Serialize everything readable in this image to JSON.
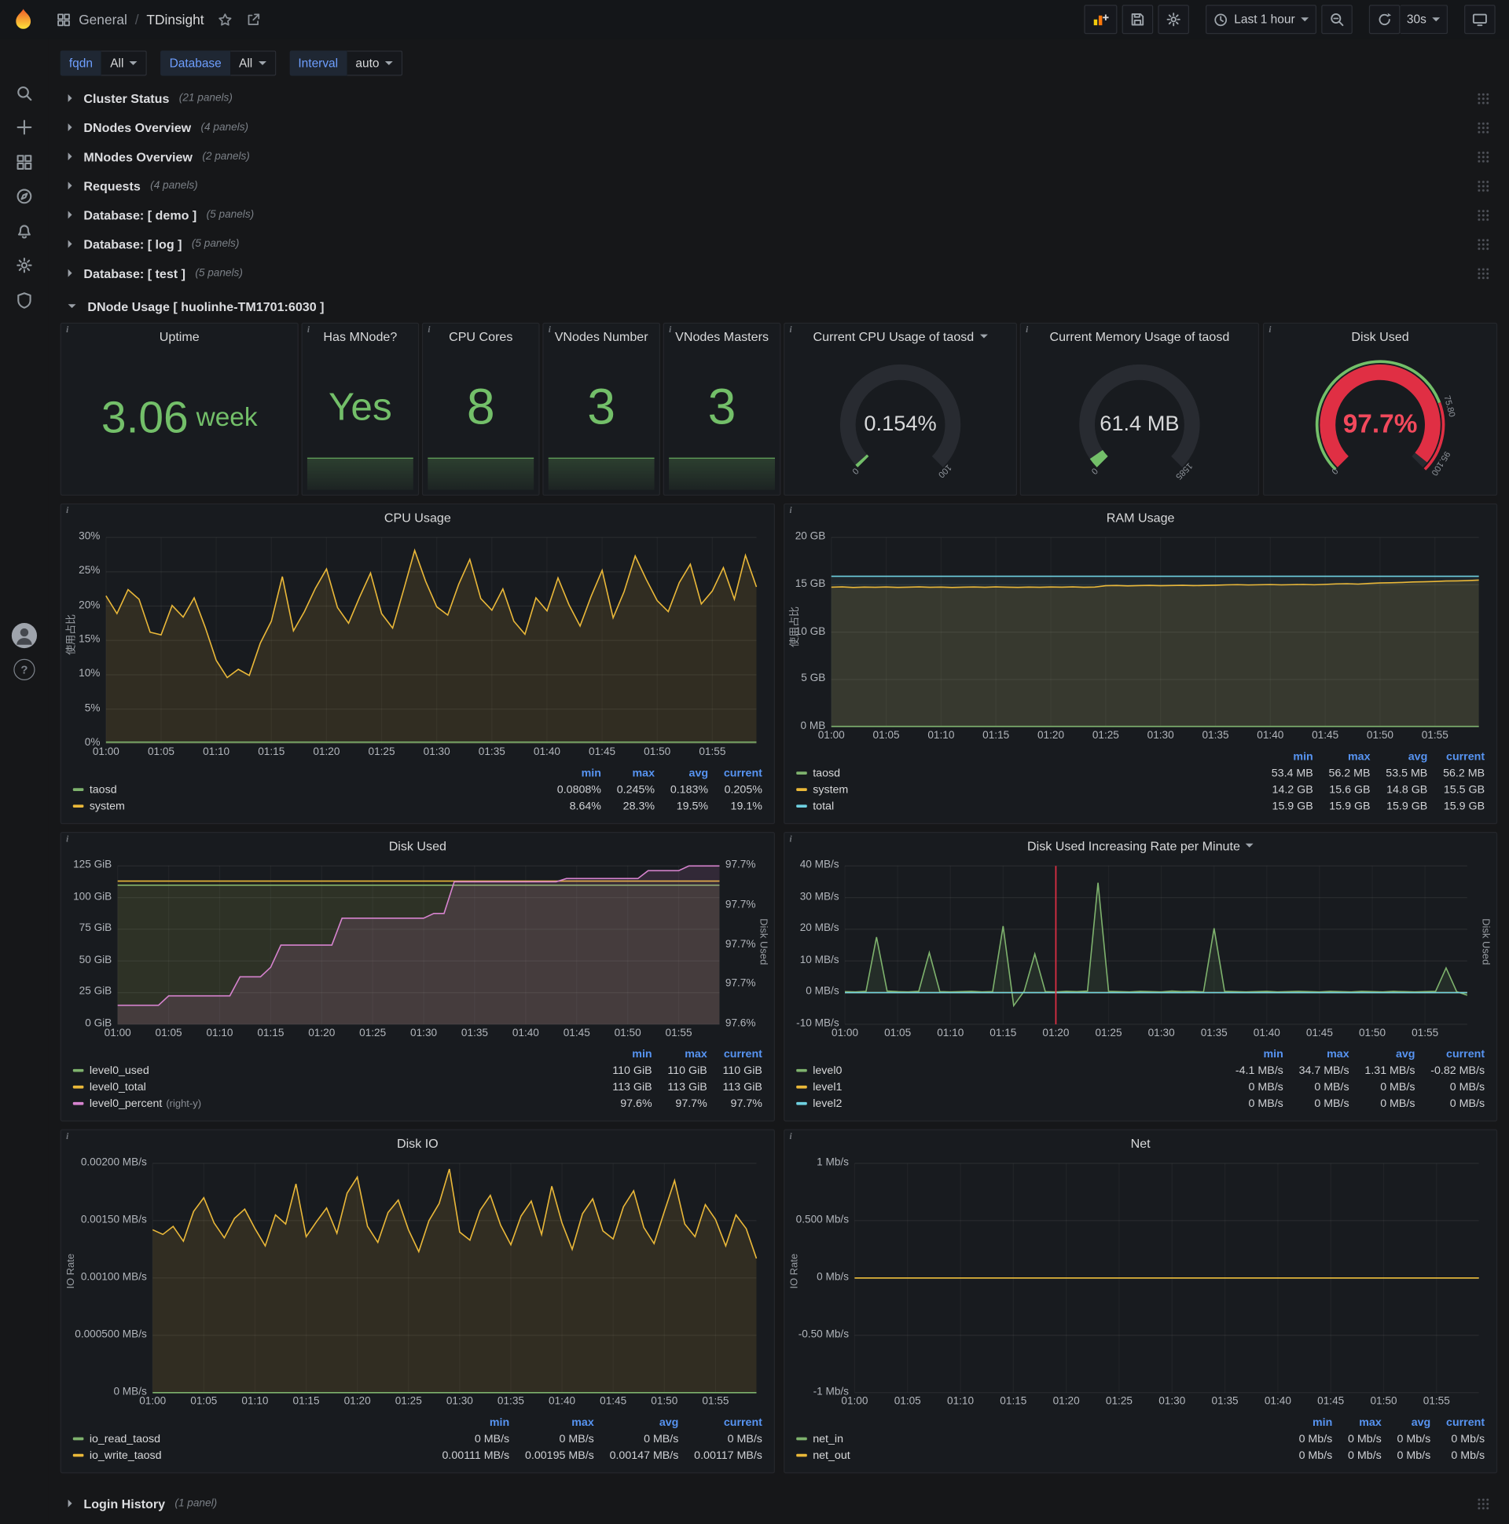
{
  "nav": {
    "section": "General",
    "separator": "/",
    "page": "TDinsight",
    "time_range": "Last 1 hour",
    "refresh": "30s"
  },
  "variables": [
    {
      "label": "fqdn",
      "value": "All"
    },
    {
      "label": "Database",
      "value": "All"
    },
    {
      "label": "Interval",
      "value": "auto"
    }
  ],
  "rows": [
    {
      "title": "Cluster Status",
      "count": "(21 panels)"
    },
    {
      "title": "DNodes Overview",
      "count": "(4 panels)"
    },
    {
      "title": "MNodes Overview",
      "count": "(2 panels)"
    },
    {
      "title": "Requests",
      "count": "(4 panels)"
    },
    {
      "title": "Database: [ demo ]",
      "count": "(5 panels)"
    },
    {
      "title": "Database: [ log ]",
      "count": "(5 panels)"
    },
    {
      "title": "Database: [ test ]",
      "count": "(5 panels)"
    }
  ],
  "expanded_row": {
    "title": "DNode Usage [ huolinhe-TM1701:6030 ]"
  },
  "bottom_row": {
    "title": "Login History",
    "count": "(1 panel)"
  },
  "stats": {
    "uptime": {
      "title": "Uptime",
      "value": "3.06",
      "unit": "week"
    },
    "has_mnode": {
      "title": "Has MNode?",
      "value": "Yes"
    },
    "cpu_cores": {
      "title": "CPU Cores",
      "value": "8"
    },
    "vnodes_number": {
      "title": "VNodes Number",
      "value": "3"
    },
    "vnodes_masters": {
      "title": "VNodes Masters",
      "value": "3"
    }
  },
  "gauges": {
    "cpu": {
      "title": "Current CPU Usage of taosd",
      "value": "0.154%",
      "min": "0",
      "max": "100",
      "fraction": 0.0015,
      "color": "#73bf69"
    },
    "memory": {
      "title": "Current Memory Usage of taosd",
      "value": "61.4 MB",
      "min": "0",
      "max": "1585",
      "fraction": 0.0387,
      "color": "#73bf69"
    },
    "disk": {
      "title": "Disk Used",
      "value": "97.7%",
      "min": "0",
      "fraction": 0.977,
      "color": "#e02f44",
      "labels": [
        {
          "text": "75.80",
          "frac": 0.778
        },
        {
          "text": "95.100",
          "frac": 0.955
        }
      ],
      "thresholds": [
        {
          "to": 0.758,
          "color": "#73bf69"
        },
        {
          "to": 1,
          "color": "#e02f44"
        }
      ]
    }
  },
  "chart_data": [
    {
      "type": "line",
      "title": "CPU Usage",
      "ylabel": "使用占比",
      "ylim": [
        0,
        30
      ],
      "yticks": [
        "30%",
        "25%",
        "20%",
        "15%",
        "10%",
        "5%",
        "0%"
      ],
      "xticks": [
        "01:00",
        "01:05",
        "01:10",
        "01:15",
        "01:20",
        "01:25",
        "01:30",
        "01:35",
        "01:40",
        "01:45",
        "01:50",
        "01:55"
      ],
      "x_minutes": 60,
      "ml": 46,
      "mr": 18,
      "legend_cols": [
        "min",
        "max",
        "avg",
        "current"
      ],
      "series": [
        {
          "name": "system",
          "color": "#eab839",
          "fill": 0.12,
          "values": [
            21.5,
            18.9,
            22.4,
            21.0,
            16.2,
            15.8,
            20.1,
            18.4,
            21.2,
            16.9,
            12.1,
            9.6,
            10.8,
            9.9,
            14.6,
            17.8,
            24.3,
            16.4,
            19.2,
            22.6,
            25.4,
            19.8,
            17.5,
            21.3,
            24.8,
            18.9,
            16.8,
            22.4,
            28.1,
            23.6,
            19.9,
            18.7,
            23.2,
            26.8,
            21.1,
            19.4,
            22.5,
            17.8,
            15.9,
            21.2,
            19.3,
            24.1,
            20.2,
            17.1,
            21.4,
            25.2,
            18.3,
            22.1,
            27.3,
            23.9,
            20.8,
            19.2,
            23.4,
            26.1,
            20.3,
            22.2,
            25.6,
            21.0,
            27.4,
            22.8
          ]
        },
        {
          "name": "taosd",
          "color": "#7eb26d",
          "fill": 0.1,
          "values": {
            "n": 60,
            "const": 0.2
          }
        }
      ],
      "legend": [
        {
          "name": "taosd",
          "color": "#7eb26d",
          "values": [
            "0.0808%",
            "0.245%",
            "0.183%",
            "0.205%"
          ]
        },
        {
          "name": "system",
          "color": "#eab839",
          "values": [
            "8.64%",
            "28.3%",
            "19.5%",
            "19.1%"
          ]
        }
      ]
    },
    {
      "type": "line",
      "title": "RAM Usage",
      "ylabel": "使用占比",
      "ylim": [
        0,
        20
      ],
      "yticks": [
        "20 GB",
        "15 GB",
        "10 GB",
        "5 GB",
        "0 MB"
      ],
      "xticks": [
        "01:00",
        "01:05",
        "01:10",
        "01:15",
        "01:20",
        "01:25",
        "01:30",
        "01:35",
        "01:40",
        "01:45",
        "01:50",
        "01:55"
      ],
      "x_minutes": 60,
      "ml": 48,
      "mr": 18,
      "legend_cols": [
        "min",
        "max",
        "avg",
        "current"
      ],
      "series": [
        {
          "name": "total",
          "color": "#6ed0e0",
          "fill": 0.08,
          "values": {
            "n": 60,
            "const": 15.9
          }
        },
        {
          "name": "system",
          "color": "#eab839",
          "fill": 0.12,
          "values": [
            14.75,
            14.78,
            14.72,
            14.76,
            14.74,
            14.77,
            14.73,
            14.75,
            14.78,
            14.74,
            14.76,
            14.72,
            14.75,
            14.77,
            14.74,
            14.78,
            14.75,
            14.73,
            14.76,
            14.74,
            14.77,
            14.75,
            14.78,
            14.74,
            14.76,
            14.9,
            14.92,
            14.88,
            14.91,
            14.93,
            14.9,
            14.92,
            14.94,
            14.91,
            14.93,
            14.95,
            15.0,
            15.02,
            14.98,
            15.01,
            15.03,
            15.0,
            15.02,
            15.04,
            15.01,
            15.05,
            15.1,
            15.12,
            15.08,
            15.15,
            15.2,
            15.22,
            15.25,
            15.3,
            15.32,
            15.35,
            15.4,
            15.42,
            15.45,
            15.5
          ]
        },
        {
          "name": "taosd",
          "color": "#7eb26d",
          "fill": 0.1,
          "values": {
            "n": 60,
            "const": 0.055
          }
        }
      ],
      "legend": [
        {
          "name": "taosd",
          "color": "#7eb26d",
          "values": [
            "53.4 MB",
            "56.2 MB",
            "53.5 MB",
            "56.2 MB"
          ]
        },
        {
          "name": "system",
          "color": "#eab839",
          "values": [
            "14.2 GB",
            "15.6 GB",
            "14.8 GB",
            "15.5 GB"
          ]
        },
        {
          "name": "total",
          "color": "#6ed0e0",
          "values": [
            "15.9 GB",
            "15.9 GB",
            "15.9 GB",
            "15.9 GB"
          ]
        }
      ]
    },
    {
      "type": "line",
      "title": "Disk Used",
      "ylim": [
        0,
        125
      ],
      "yticks": [
        "125 GiB",
        "100 GiB",
        "75 GiB",
        "50 GiB",
        "25 GiB",
        "0 GiB"
      ],
      "y2lim": [
        97.6,
        97.7
      ],
      "y2ticks": [
        "97.7%",
        "97.7%",
        "97.7%",
        "97.7%",
        "97.6%"
      ],
      "y2label": "Disk Used",
      "xticks": [
        "01:00",
        "01:05",
        "01:10",
        "01:15",
        "01:20",
        "01:25",
        "01:30",
        "01:35",
        "01:40",
        "01:45",
        "01:50",
        "01:55"
      ],
      "x_minutes": 60,
      "ml": 58,
      "mr": 56,
      "legend_cols": [
        "min",
        "max",
        "current"
      ],
      "series": [
        {
          "name": "level0_used",
          "color": "#7eb26d",
          "fill": 0.1,
          "values": {
            "n": 60,
            "const": 109.8
          }
        },
        {
          "name": "level0_total",
          "color": "#eab839",
          "fill": 0.06,
          "values": {
            "n": 60,
            "const": 113
          }
        },
        {
          "name": "level0_percent",
          "color": "#d683ce",
          "fill": 0.14,
          "axis": "right",
          "values": [
            97.612,
            97.612,
            97.612,
            97.612,
            97.612,
            97.618,
            97.618,
            97.618,
            97.618,
            97.618,
            97.618,
            97.618,
            97.63,
            97.63,
            97.63,
            97.636,
            97.65,
            97.65,
            97.65,
            97.65,
            97.65,
            97.65,
            97.667,
            97.667,
            97.667,
            97.667,
            97.667,
            97.667,
            97.667,
            97.667,
            97.667,
            97.67,
            97.67,
            97.69,
            97.69,
            97.69,
            97.69,
            97.69,
            97.69,
            97.69,
            97.69,
            97.69,
            97.69,
            97.69,
            97.692,
            97.692,
            97.692,
            97.692,
            97.692,
            97.692,
            97.692,
            97.692,
            97.697,
            97.697,
            97.697,
            97.697,
            97.7,
            97.7,
            97.7,
            97.7
          ]
        }
      ],
      "legend": [
        {
          "name": "level0_used",
          "color": "#7eb26d",
          "values": [
            "110 GiB",
            "110 GiB",
            "110 GiB"
          ]
        },
        {
          "name": "level0_total",
          "color": "#eab839",
          "values": [
            "113 GiB",
            "113 GiB",
            "113 GiB"
          ]
        },
        {
          "name": "level0_percent",
          "color": "#d683ce",
          "suffix": "(right-y)",
          "values": [
            "97.6%",
            "97.7%",
            "97.7%"
          ]
        }
      ]
    },
    {
      "type": "line",
      "title": "Disk Used Increasing Rate per Minute",
      "ylim": [
        -10,
        40
      ],
      "yticks": [
        "40 MB/s",
        "30 MB/s",
        "20 MB/s",
        "10 MB/s",
        "0 MB/s",
        "-10 MB/s"
      ],
      "y2label": "Disk Used",
      "xticks": [
        "01:00",
        "01:05",
        "01:10",
        "01:15",
        "01:20",
        "01:25",
        "01:30",
        "01:35",
        "01:40",
        "01:45",
        "01:50",
        "01:55"
      ],
      "x_minutes": 60,
      "ml": 62,
      "mr": 30,
      "annotation_min": 20,
      "legend_cols": [
        "min",
        "max",
        "avg",
        "current"
      ],
      "series": [
        {
          "name": "level0",
          "color": "#7eb26d",
          "fill": 0.12,
          "values": [
            0.3,
            0.2,
            0.4,
            17.5,
            0.5,
            0.3,
            0.2,
            0.4,
            12.6,
            0.3,
            0.2,
            0.3,
            0.4,
            0.2,
            0.3,
            21.0,
            -4.1,
            0.5,
            12.2,
            0.3,
            0.2,
            0.4,
            0.3,
            0.5,
            34.7,
            0.4,
            0.3,
            0.2,
            0.4,
            0.3,
            0.2,
            0.5,
            0.3,
            0.4,
            0.2,
            20.3,
            0.4,
            0.3,
            0.2,
            0.3,
            0.4,
            0.2,
            0.3,
            0.4,
            0.3,
            0.2,
            0.4,
            0.3,
            0.2,
            0.4,
            0.3,
            0.2,
            0.4,
            0.3,
            0.2,
            0.3,
            0.4,
            7.8,
            0.3,
            -0.8
          ]
        },
        {
          "name": "level1",
          "color": "#eab839",
          "fill": 0,
          "values": {
            "n": 60,
            "const": 0
          }
        },
        {
          "name": "level2",
          "color": "#6ed0e0",
          "fill": 0,
          "values": {
            "n": 60,
            "const": 0
          }
        }
      ],
      "legend": [
        {
          "name": "level0",
          "color": "#7eb26d",
          "values": [
            "-4.1 MB/s",
            "34.7 MB/s",
            "1.31 MB/s",
            "-0.82 MB/s"
          ]
        },
        {
          "name": "level1",
          "color": "#eab839",
          "values": [
            "0 MB/s",
            "0 MB/s",
            "0 MB/s",
            "0 MB/s"
          ]
        },
        {
          "name": "level2",
          "color": "#6ed0e0",
          "values": [
            "0 MB/s",
            "0 MB/s",
            "0 MB/s",
            "0 MB/s"
          ]
        }
      ]
    },
    {
      "type": "line",
      "title": "Disk IO",
      "ylabel": "IO Rate",
      "ylim": [
        0,
        0.002
      ],
      "yticks": [
        "0.00200 MB/s",
        "0.00150 MB/s",
        "0.00100 MB/s",
        "0.000500 MB/s",
        "0 MB/s"
      ],
      "xticks": [
        "01:00",
        "01:05",
        "01:10",
        "01:15",
        "01:20",
        "01:25",
        "01:30",
        "01:35",
        "01:40",
        "01:45",
        "01:50",
        "01:55"
      ],
      "x_minutes": 60,
      "ml": 94,
      "mr": 18,
      "legend_cols": [
        "min",
        "max",
        "avg",
        "current"
      ],
      "series": [
        {
          "name": "io_write_taosd",
          "color": "#eab839",
          "fill": 0.12,
          "values": [
            0.00142,
            0.00138,
            0.00145,
            0.00132,
            0.00158,
            0.0017,
            0.00148,
            0.00135,
            0.00152,
            0.0016,
            0.00143,
            0.00128,
            0.00155,
            0.00147,
            0.00182,
            0.00136,
            0.00149,
            0.00161,
            0.00139,
            0.00174,
            0.00188,
            0.00145,
            0.00131,
            0.00157,
            0.00168,
            0.00142,
            0.00123,
            0.0015,
            0.00165,
            0.00195,
            0.0014,
            0.00133,
            0.00159,
            0.00172,
            0.00146,
            0.00129,
            0.00154,
            0.00167,
            0.00138,
            0.0018,
            0.00148,
            0.00125,
            0.00156,
            0.00169,
            0.00141,
            0.00134,
            0.00162,
            0.00176,
            0.00144,
            0.0013,
            0.00158,
            0.00185,
            0.00147,
            0.00136,
            0.00164,
            0.00151,
            0.00128,
            0.00155,
            0.00143,
            0.00117
          ]
        },
        {
          "name": "io_read_taosd",
          "color": "#7eb26d",
          "fill": 0.1,
          "values": {
            "n": 60,
            "const": 0
          }
        }
      ],
      "legend": [
        {
          "name": "io_read_taosd",
          "color": "#7eb26d",
          "values": [
            "0 MB/s",
            "0 MB/s",
            "0 MB/s",
            "0 MB/s"
          ]
        },
        {
          "name": "io_write_taosd",
          "color": "#eab839",
          "values": [
            "0.00111 MB/s",
            "0.00195 MB/s",
            "0.00147 MB/s",
            "0.00117 MB/s"
          ]
        }
      ]
    },
    {
      "type": "line",
      "title": "Net",
      "ylabel": "IO Rate",
      "ylim": [
        -1,
        1
      ],
      "yticks": [
        "1 Mb/s",
        "0.500 Mb/s",
        "0 Mb/s",
        "-0.50 Mb/s",
        "-1 Mb/s"
      ],
      "xticks": [
        "01:00",
        "01:05",
        "01:10",
        "01:15",
        "01:20",
        "01:25",
        "01:30",
        "01:35",
        "01:40",
        "01:45",
        "01:50",
        "01:55"
      ],
      "x_minutes": 60,
      "ml": 72,
      "mr": 18,
      "legend_cols": [
        "min",
        "max",
        "avg",
        "current"
      ],
      "series": [
        {
          "name": "net_in",
          "color": "#7eb26d",
          "fill": 0,
          "values": {
            "n": 60,
            "const": 0
          }
        },
        {
          "name": "net_out",
          "color": "#eab839",
          "fill": 0,
          "values": {
            "n": 60,
            "const": 0
          }
        }
      ],
      "legend": [
        {
          "name": "net_in",
          "color": "#7eb26d",
          "values": [
            "0 Mb/s",
            "0 Mb/s",
            "0 Mb/s",
            "0 Mb/s"
          ]
        },
        {
          "name": "net_out",
          "color": "#eab839",
          "values": [
            "0 Mb/s",
            "0 Mb/s",
            "0 Mb/s",
            "0 Mb/s"
          ]
        }
      ]
    }
  ]
}
